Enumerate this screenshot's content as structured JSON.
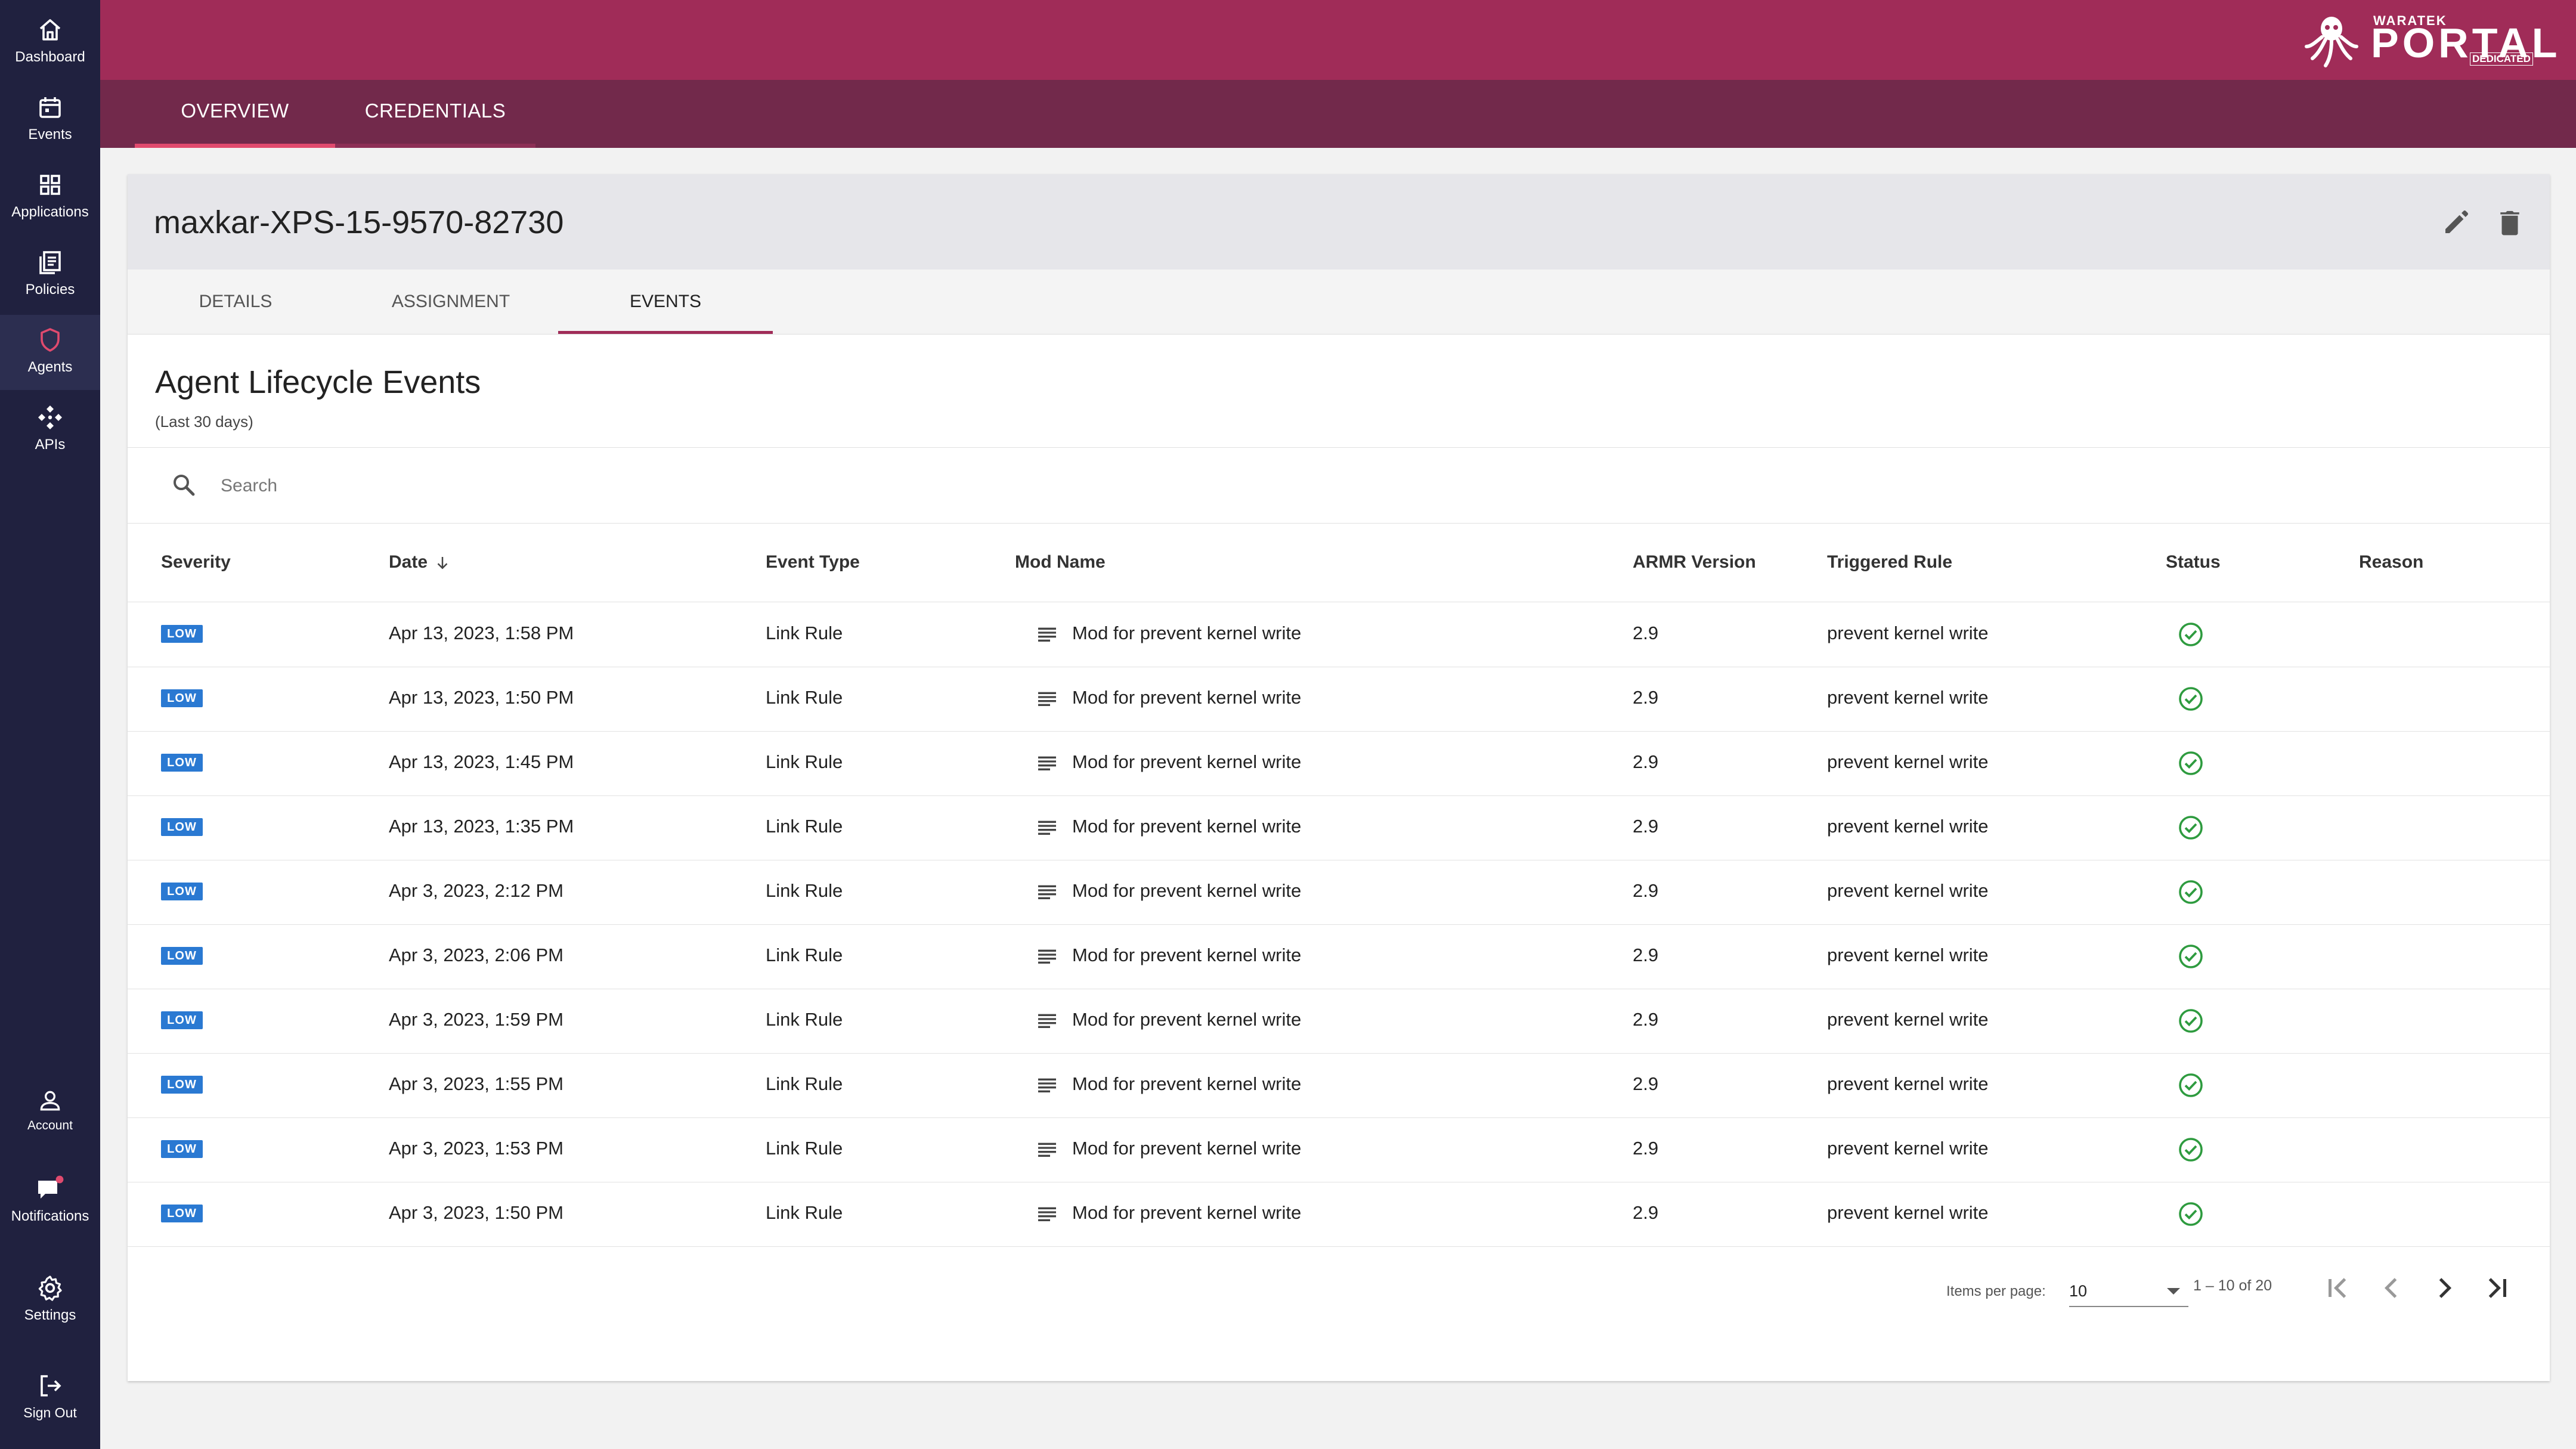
{
  "sidebar": {
    "items": [
      {
        "label": "Dashboard",
        "icon": "home-icon"
      },
      {
        "label": "Events",
        "icon": "calendar-icon"
      },
      {
        "label": "Applications",
        "icon": "grid-icon"
      },
      {
        "label": "Policies",
        "icon": "policies-icon"
      },
      {
        "label": "Agents",
        "icon": "shield-icon"
      },
      {
        "label": "APIs",
        "icon": "api-icon"
      }
    ],
    "bottom_items": [
      {
        "label": "Account",
        "icon": "person-icon"
      },
      {
        "label": "Notifications",
        "icon": "chat-icon"
      },
      {
        "label": "Settings",
        "icon": "gear-icon"
      },
      {
        "label": "Sign Out",
        "icon": "sign-out-icon"
      }
    ]
  },
  "header": {
    "logo_top": "WARATEK",
    "logo_main": "PORTAL",
    "logo_badge": "DEDICATED",
    "tabs": [
      "OVERVIEW",
      "CREDENTIALS"
    ]
  },
  "agent": {
    "name": "maxkar-XPS-15-9570-82730",
    "tabs": [
      "DETAILS",
      "ASSIGNMENT",
      "EVENTS"
    ],
    "active_tab": "EVENTS"
  },
  "events": {
    "title": "Agent Lifecycle Events",
    "subtitle": "(Last 30 days)",
    "search_placeholder": "Search",
    "columns": [
      "Severity",
      "Date",
      "Event Type",
      "Mod Name",
      "ARMR Version",
      "Triggered Rule",
      "Status",
      "Reason"
    ],
    "rows": [
      {
        "severity": "LOW",
        "date": "Apr 13, 2023, 1:58 PM",
        "event_type": "Link Rule",
        "mod_name": "Mod for prevent kernel write",
        "armr_version": "2.9",
        "triggered_rule": "prevent kernel write",
        "status": "success",
        "reason": ""
      },
      {
        "severity": "LOW",
        "date": "Apr 13, 2023, 1:50 PM",
        "event_type": "Link Rule",
        "mod_name": "Mod for prevent kernel write",
        "armr_version": "2.9",
        "triggered_rule": "prevent kernel write",
        "status": "success",
        "reason": ""
      },
      {
        "severity": "LOW",
        "date": "Apr 13, 2023, 1:45 PM",
        "event_type": "Link Rule",
        "mod_name": "Mod for prevent kernel write",
        "armr_version": "2.9",
        "triggered_rule": "prevent kernel write",
        "status": "success",
        "reason": ""
      },
      {
        "severity": "LOW",
        "date": "Apr 13, 2023, 1:35 PM",
        "event_type": "Link Rule",
        "mod_name": "Mod for prevent kernel write",
        "armr_version": "2.9",
        "triggered_rule": "prevent kernel write",
        "status": "success",
        "reason": ""
      },
      {
        "severity": "LOW",
        "date": "Apr 3, 2023, 2:12 PM",
        "event_type": "Link Rule",
        "mod_name": "Mod for prevent kernel write",
        "armr_version": "2.9",
        "triggered_rule": "prevent kernel write",
        "status": "success",
        "reason": ""
      },
      {
        "severity": "LOW",
        "date": "Apr 3, 2023, 2:06 PM",
        "event_type": "Link Rule",
        "mod_name": "Mod for prevent kernel write",
        "armr_version": "2.9",
        "triggered_rule": "prevent kernel write",
        "status": "success",
        "reason": ""
      },
      {
        "severity": "LOW",
        "date": "Apr 3, 2023, 1:59 PM",
        "event_type": "Link Rule",
        "mod_name": "Mod for prevent kernel write",
        "armr_version": "2.9",
        "triggered_rule": "prevent kernel write",
        "status": "success",
        "reason": ""
      },
      {
        "severity": "LOW",
        "date": "Apr 3, 2023, 1:55 PM",
        "event_type": "Link Rule",
        "mod_name": "Mod for prevent kernel write",
        "armr_version": "2.9",
        "triggered_rule": "prevent kernel write",
        "status": "success",
        "reason": ""
      },
      {
        "severity": "LOW",
        "date": "Apr 3, 2023, 1:53 PM",
        "event_type": "Link Rule",
        "mod_name": "Mod for prevent kernel write",
        "armr_version": "2.9",
        "triggered_rule": "prevent kernel write",
        "status": "success",
        "reason": ""
      },
      {
        "severity": "LOW",
        "date": "Apr 3, 2023, 1:50 PM",
        "event_type": "Link Rule",
        "mod_name": "Mod for prevent kernel write",
        "armr_version": "2.9",
        "triggered_rule": "prevent kernel write",
        "status": "success",
        "reason": ""
      }
    ]
  },
  "paginator": {
    "items_per_page_label": "Items per page:",
    "items_per_page": "10",
    "range": "1 – 10 of 20"
  },
  "colors": {
    "sidebar_bg": "#20213f",
    "header_bg": "#a02c58",
    "tabbar_bg": "#72294b",
    "badge_low": "#2a79d2",
    "status_ok": "#2e9b3f"
  }
}
